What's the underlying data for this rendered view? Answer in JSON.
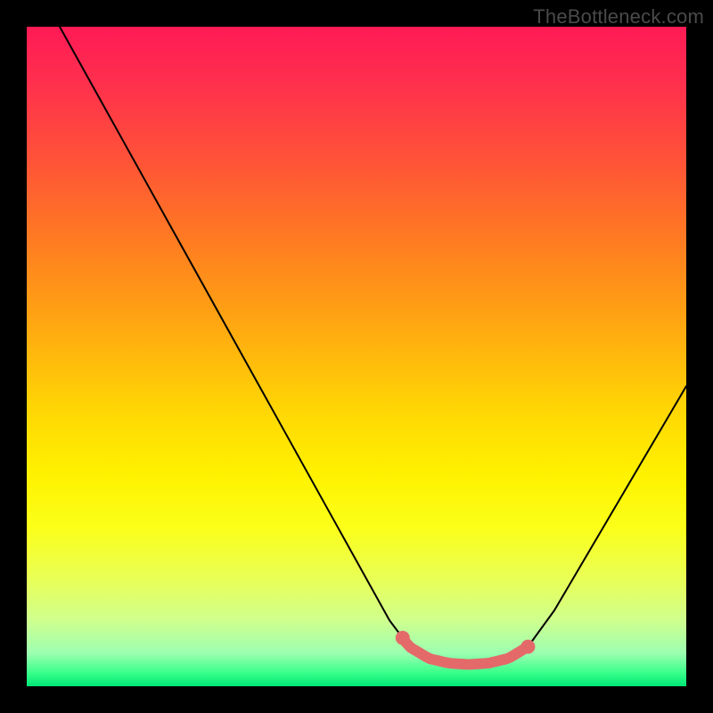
{
  "watermark": "TheBottleneck.com",
  "chart_data": {
    "type": "line",
    "title": "",
    "xlabel": "",
    "ylabel": "",
    "xlim": [
      0,
      100
    ],
    "ylim": [
      0,
      100
    ],
    "series": [
      {
        "name": "curve",
        "x": [
          5,
          10,
          15,
          20,
          25,
          30,
          35,
          40,
          45,
          50,
          55,
          58,
          61,
          64,
          67,
          70,
          73,
          76,
          80,
          85,
          90,
          95,
          100
        ],
        "values": [
          100,
          91,
          82,
          73,
          64,
          55,
          46,
          37,
          28,
          19,
          10,
          6,
          4.2,
          3.5,
          3.3,
          3.5,
          4.2,
          6,
          11.5,
          20,
          28.5,
          37,
          45.5
        ]
      }
    ],
    "highlight": {
      "color": "#e46a6a",
      "note": "flat region near curve minimum",
      "x_range": [
        57,
        76
      ],
      "y_approx": 3.6
    },
    "background_gradient": {
      "direction": "top-to-bottom",
      "stops": [
        "#ff1a55",
        "#ffd604",
        "#00e676"
      ]
    }
  }
}
